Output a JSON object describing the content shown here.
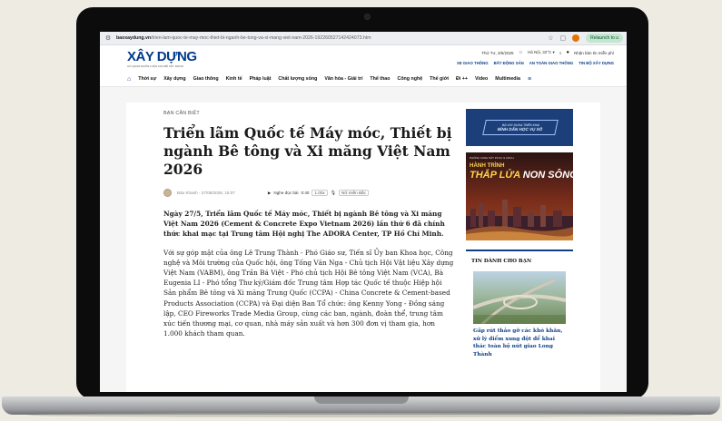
{
  "browser": {
    "url_host": "baoxaydung.vn",
    "url_path": "/trien-lam-quoc-te-may-moc-thiet-bi-nganh-be-tong-va-xi-mang-viet-nam-2026-192260527142424073.htm",
    "relaunch_label": "Relaunch to u"
  },
  "site": {
    "logo": "XÂY DỰNG",
    "logo_sub": "CƠ QUAN NGÔN LUẬN CỦA BỘ XÂY DỰNG",
    "date": "Thứ Tư, 3/6/2026",
    "weather": "Hà Nội, 32°C ▾",
    "signup": "Nhận bản tin miễn phí",
    "links": [
      "XE GIAO THÔNG",
      "BẤT ĐỘNG SẢN",
      "AN TOÀN GIAO THÔNG",
      "TIN BỘ XÂY DỰNG"
    ]
  },
  "nav": {
    "items": [
      "Thời sự",
      "Xây dựng",
      "Giao thông",
      "Kinh tế",
      "Pháp luật",
      "Chất lượng sống",
      "Văn hóa - Giải trí",
      "Thể thao",
      "Công nghệ",
      "Thế giới",
      "Đi ++",
      "Video",
      "Multimedia"
    ]
  },
  "article": {
    "category": "BẠN CẦN BIẾT",
    "title": "Triển lãm Quốc tế Máy móc, Thiết bị ngành Bê tông và Xi măng Việt Nam 2026",
    "author_time": "Bảo Khanh - 27/05/2026, 15:07",
    "listen_label": "Nghe đọc bài",
    "listen_time": "0:40",
    "speed": "1.00x",
    "voice": "Nữ miền Bắc",
    "lead": "Ngày 27/5, Triển lãm Quốc tế Máy móc, Thiết bị ngành Bê tông và Xi măng Việt Nam 2026 (Cement & Concrete Expo Vietnam 2026) lần thứ 6 đã chính thức khai mạc tại Trung tâm Hội nghị The ADORA Center, TP Hồ Chí Minh.",
    "body": "Với sự góp mặt của ông Lê Trung Thành - Phó Giáo sư, Tiến sĩ Ủy ban Khoa học, Công nghệ và Môi trường của Quốc hội, ông Tống Văn Nga - Chủ tịch Hội Vật liệu Xây dựng Việt Nam (VABM), ông Trần Bá Việt - Phó chủ tịch Hội Bê tông Việt Nam (VCA), Bà Eugenia LI - Phó tổng Thư ký/Giám đốc Trung tâm Hợp tác Quốc tế thuộc Hiệp hội Sản phẩm Bê tông và Xi măng Trung Quốc (CCPA) - China Concrete & Cement-based Products Association (CCPA) và Đại diện Ban Tổ chức: ông Kenny Yong - Đồng sáng lập, CEO Fireworks Trade Media Group, cùng các ban, ngành, đoàn thể, trung tâm xúc tiến thương mại, cơ quan, nhà máy sản xuất và hơn 300 đơn vị tham gia, hơn 1.000 khách tham quan."
  },
  "sidebar": {
    "ad1_line1": "BỘ XÂY DỰNG TRIỂN KHAI",
    "ad1_line2": "BÌNH DÂN HỌC VỤ SỐ",
    "ad2_small": "PHÒNG CẢNH SÁT PCCC & CNCH",
    "ad2_line1": "HÀNH TRÌNH",
    "ad2_line2a": "THẮP LỬA",
    "ad2_line2b": " NON SÔNG",
    "box_title": "TIN DÀNH CHO BẠN",
    "box_link": "Gấp rút thảo gỡ các khó khăn, xử lý điểm xung đột để khai thác toàn bộ nút giao Long Thành"
  },
  "icons": {
    "site_settings": "tune-icon",
    "bookmark": "star-icon",
    "weather": "sun-icon",
    "search": "search-icon",
    "user": "user-icon",
    "home": "home-icon",
    "menu": "hamburger-icon"
  }
}
